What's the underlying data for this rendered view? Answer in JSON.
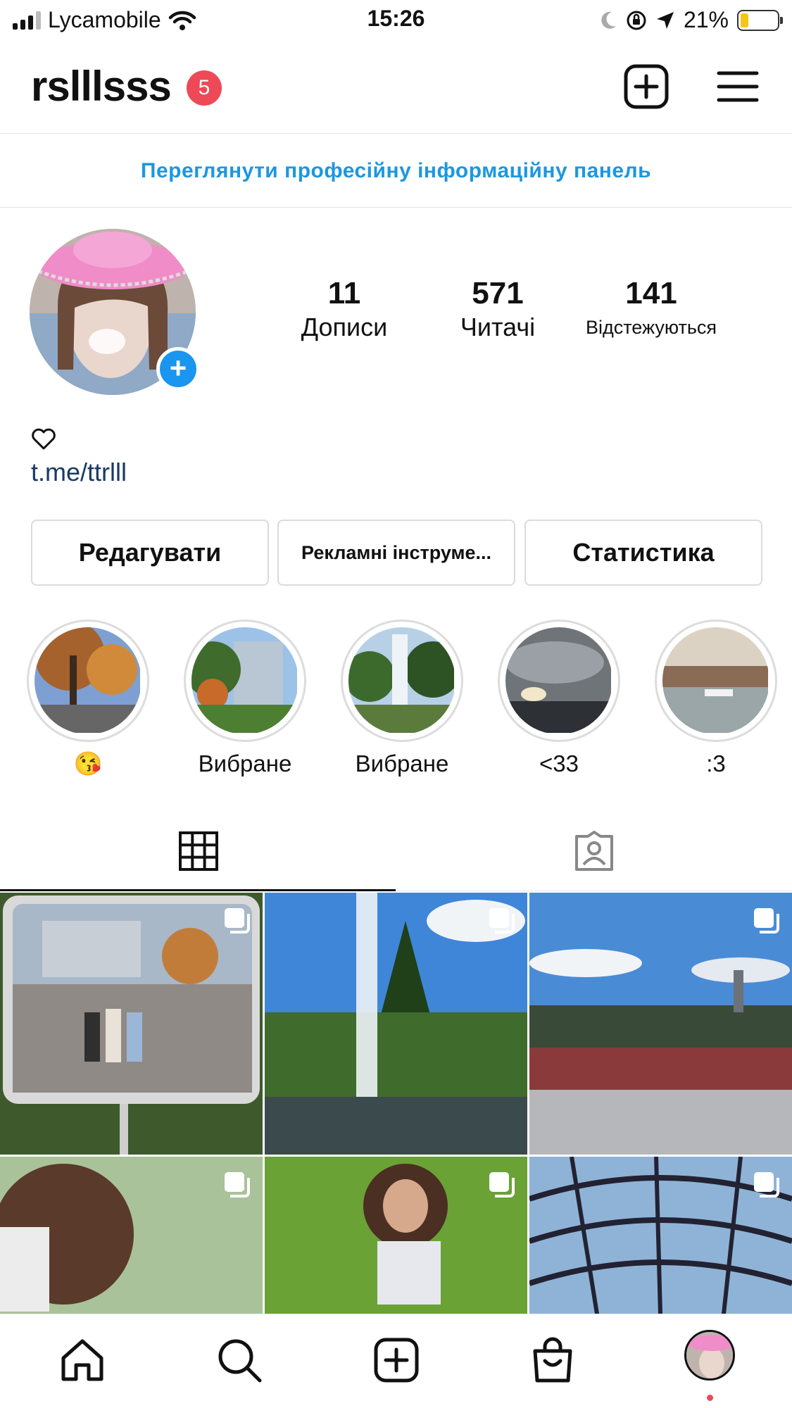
{
  "status_bar": {
    "carrier": "Lycamobile",
    "time": "15:26",
    "battery": "21%",
    "battery_level": 0.21,
    "icons": [
      "signal-icon",
      "wifi-icon",
      "moon-icon",
      "orientation-lock-icon",
      "location-icon",
      "battery-icon"
    ]
  },
  "header": {
    "username": "rslllsss",
    "notifications": "5"
  },
  "dashboard_banner": "Переглянути професійну інформаційну панель",
  "stats": [
    {
      "value": "11",
      "label": "Дописи"
    },
    {
      "value": "571",
      "label": "Читачі"
    },
    {
      "value": "141",
      "label": "Відстежуються"
    }
  ],
  "bio": {
    "link": "t.me/ttrlll"
  },
  "buttons": {
    "edit": "Редагувати",
    "ad_tools": "Рекламні інструме...",
    "insights": "Статистика"
  },
  "highlights": [
    {
      "label": "😘"
    },
    {
      "label": "Вибране"
    },
    {
      "label": "Вибране"
    },
    {
      "label": "<33"
    },
    {
      "label": ":3"
    }
  ],
  "colors": {
    "accent_blue": "#1c97e0",
    "badge_red": "#ed4956",
    "link": "#1a3a63"
  }
}
